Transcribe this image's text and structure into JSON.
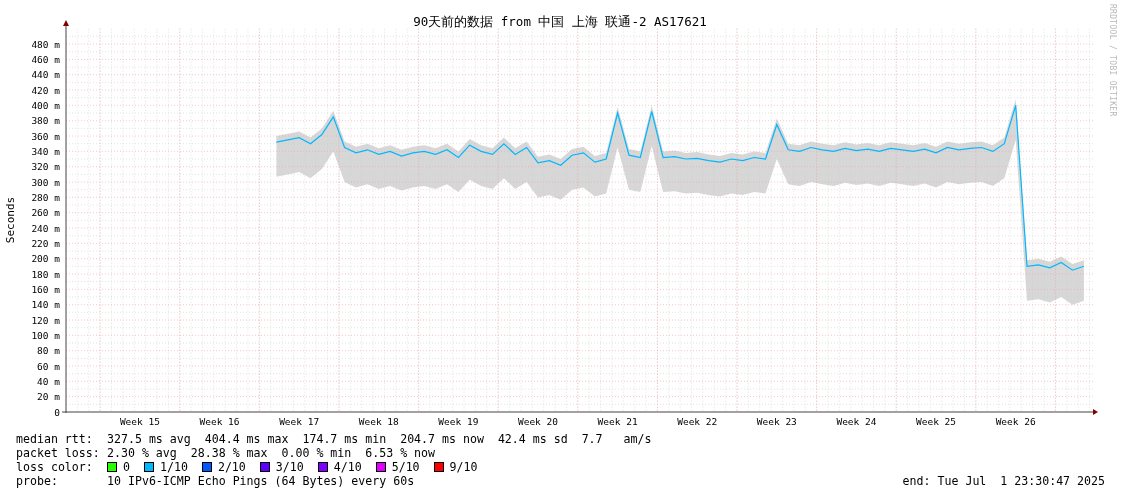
{
  "chart": {
    "chart_data": {
      "type": "line",
      "title": "90天前的数据 from 中国 上海 联通-2 AS17621",
      "ylabel": "Seconds",
      "categories": [
        null,
        null,
        null,
        null,
        null,
        null,
        "Week 15",
        null,
        null,
        null,
        null,
        null,
        null,
        "Week 16",
        null,
        null,
        null,
        null,
        null,
        null,
        "Week 17",
        null,
        null,
        null,
        null,
        null,
        null,
        "Week 18",
        null,
        null,
        null,
        null,
        null,
        null,
        "Week 19",
        null,
        null,
        null,
        null,
        null,
        null,
        "Week 20",
        null,
        null,
        null,
        null,
        null,
        null,
        "Week 21",
        null,
        null,
        null,
        null,
        null,
        null,
        "Week 22",
        null,
        null,
        null,
        null,
        null,
        null,
        "Week 23",
        null,
        null,
        null,
        null,
        null,
        null,
        "Week 24",
        null,
        null,
        null,
        null,
        null,
        null,
        "Week 25",
        null,
        null,
        null,
        null,
        null,
        null,
        "Week 26",
        null,
        null,
        null,
        null,
        null,
        null
      ],
      "series": [
        {
          "color": "#00b8ff",
          "values": [
            null,
            null,
            null,
            null,
            null,
            null,
            null,
            null,
            null,
            null,
            null,
            null,
            null,
            null,
            null,
            null,
            null,
            null,
            352,
            355,
            358,
            350,
            362,
            385,
            345,
            338,
            342,
            336,
            340,
            334,
            338,
            340,
            336,
            342,
            332,
            348,
            340,
            336,
            350,
            336,
            345,
            325,
            328,
            322,
            335,
            338,
            326,
            330,
            390,
            335,
            332,
            392,
            332,
            333,
            330,
            331,
            328,
            326,
            330,
            328,
            332,
            330,
            375,
            342,
            340,
            345,
            342,
            340,
            344,
            341,
            343,
            340,
            344,
            342,
            340,
            343,
            338,
            345,
            342,
            344,
            345,
            340,
            350,
            400,
            190,
            192,
            188,
            195,
            185,
            190
          ]
        }
      ],
      "ylim": [
        0,
        500
      ],
      "grid": true,
      "yticks": [
        {
          "value": 0,
          "label": "0"
        },
        {
          "value": 20,
          "label": "20 m"
        },
        {
          "value": 40,
          "label": "40 m"
        },
        {
          "value": 60,
          "label": "60 m"
        },
        {
          "value": 80,
          "label": "80 m"
        },
        {
          "value": 100,
          "label": "100 m"
        },
        {
          "value": 120,
          "label": "120 m"
        },
        {
          "value": 140,
          "label": "140 m"
        },
        {
          "value": 160,
          "label": "160 m"
        },
        {
          "value": 180,
          "label": "180 m"
        },
        {
          "value": 200,
          "label": "200 m"
        },
        {
          "value": 220,
          "label": "220 m"
        },
        {
          "value": 240,
          "label": "240 m"
        },
        {
          "value": 260,
          "label": "260 m"
        },
        {
          "value": 280,
          "label": "280 m"
        },
        {
          "value": 300,
          "label": "300 m"
        },
        {
          "value": 320,
          "label": "320 m"
        },
        {
          "value": 340,
          "label": "340 m"
        },
        {
          "value": 360,
          "label": "360 m"
        },
        {
          "value": 380,
          "label": "380 m"
        },
        {
          "value": 400,
          "label": "400 m"
        },
        {
          "value": 420,
          "label": "420 m"
        },
        {
          "value": 440,
          "label": "440 m"
        },
        {
          "value": 460,
          "label": "460 m"
        },
        {
          "value": 480,
          "label": "480 m"
        }
      ]
    }
  },
  "side_label": "RRDTOOL / TOBI OETIKER",
  "stats": [
    {
      "label": "median rtt:",
      "value": "327.5 ms avg  404.4 ms max  174.7 ms min  204.7 ms now  42.4 ms sd  7.7   am/s"
    },
    {
      "label": "packet loss:",
      "value": "2.30 % avg  28.38 % max  0.00 % min  6.53 % now"
    }
  ],
  "loss_legend": {
    "label": "loss color:",
    "items": [
      {
        "label": "0",
        "color": "#26ff00"
      },
      {
        "label": "1/10",
        "color": "#00b8ff"
      },
      {
        "label": "2/10",
        "color": "#0059ff"
      },
      {
        "label": "3/10",
        "color": "#5e00ff"
      },
      {
        "label": "4/10",
        "color": "#7e00ff"
      },
      {
        "label": "5/10",
        "color": "#dd00ff"
      },
      {
        "label": "9/10",
        "color": "#ff0000"
      }
    ]
  },
  "probe": {
    "label": "probe:",
    "value": "10 IPv6-ICMP Echo Pings (64 Bytes) every 60s"
  },
  "end": "end: Tue Jul  1 23:30:47 2025"
}
